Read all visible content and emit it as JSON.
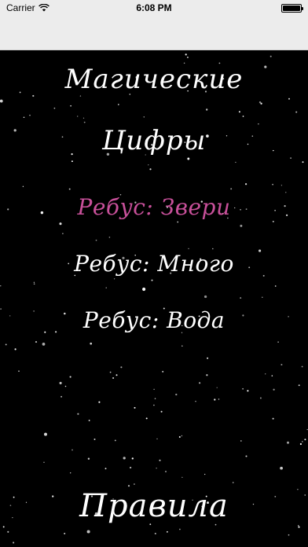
{
  "status_bar": {
    "carrier": "Carrier",
    "time": "6:08 PM",
    "battery_level": 1.0
  },
  "main": {
    "title_line1": "Магические",
    "title_line2": "Цифры",
    "menu": [
      {
        "label": "Ребус: Звери",
        "color": "#c8509a"
      },
      {
        "label": "Ребус: Много",
        "color": "#ffffff"
      },
      {
        "label": "Ребус: Вода",
        "color": "#ffffff"
      }
    ],
    "rules_label": "Правила"
  },
  "colors": {
    "background": "#000000",
    "status_bar": "#ececec",
    "accent": "#c8509a",
    "text": "#ffffff"
  }
}
